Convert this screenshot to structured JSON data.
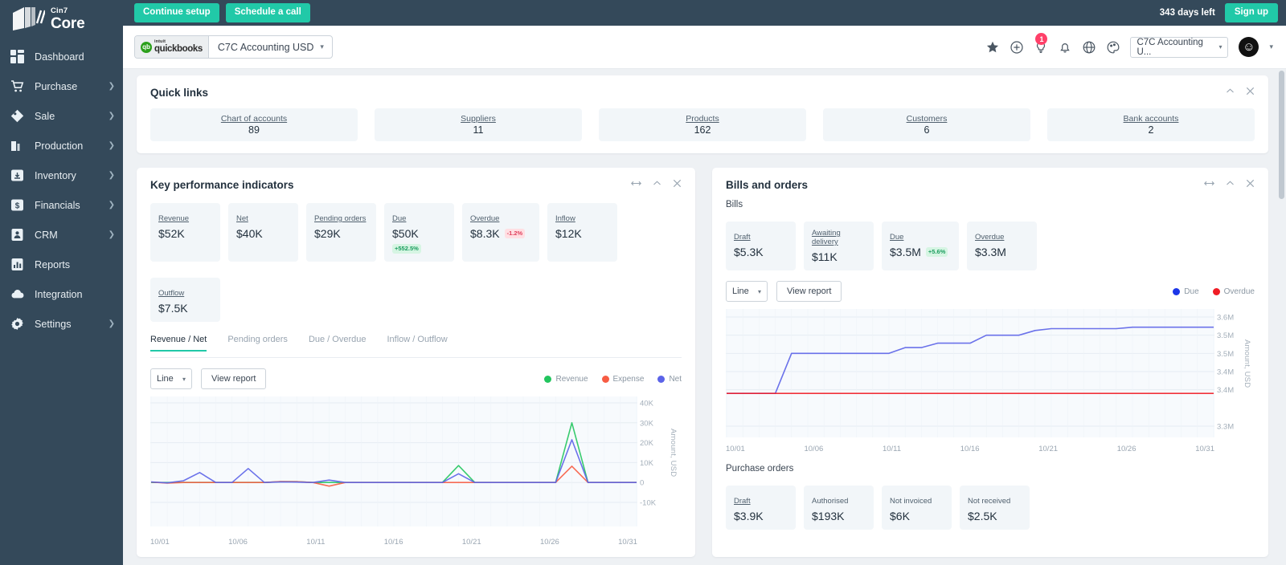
{
  "brand": {
    "top": "Cin7",
    "bottom": "Core"
  },
  "sidebar": {
    "items": [
      {
        "label": "Dashboard",
        "icon": "grid-icon",
        "expandable": false
      },
      {
        "label": "Purchase",
        "icon": "cart-icon",
        "expandable": true
      },
      {
        "label": "Sale",
        "icon": "tag-icon",
        "expandable": true
      },
      {
        "label": "Production",
        "icon": "factory-icon",
        "expandable": true
      },
      {
        "label": "Inventory",
        "icon": "box-icon",
        "expandable": true
      },
      {
        "label": "Financials",
        "icon": "dollar-icon",
        "expandable": true
      },
      {
        "label": "CRM",
        "icon": "contact-icon",
        "expandable": true
      },
      {
        "label": "Reports",
        "icon": "bar-chart-icon",
        "expandable": false
      },
      {
        "label": "Integration",
        "icon": "cloud-icon",
        "expandable": false
      },
      {
        "label": "Settings",
        "icon": "gear-icon",
        "expandable": true
      }
    ]
  },
  "topbar": {
    "continue_setup": "Continue setup",
    "schedule_call": "Schedule a call",
    "days_left": "343 days left",
    "signup": "Sign up",
    "accent": "#21c9a8"
  },
  "subheader": {
    "connector_brand_small": "intuit",
    "connector_brand": "quickbooks",
    "connector_value": "C7C Accounting USD",
    "notification_count": "1",
    "org_value": "C7C Accounting U...",
    "icons": [
      "star-icon",
      "plus-circle-icon",
      "lightbulb-icon",
      "bell-icon",
      "globe-icon",
      "palette-icon"
    ]
  },
  "quick_links": {
    "title": "Quick links",
    "tiles": [
      {
        "label": "Chart of accounts",
        "value": "89"
      },
      {
        "label": "Suppliers",
        "value": "11"
      },
      {
        "label": "Products",
        "value": "162"
      },
      {
        "label": "Customers",
        "value": "6"
      },
      {
        "label": "Bank accounts",
        "value": "2"
      }
    ]
  },
  "kpi": {
    "title": "Key performance indicators",
    "tiles": [
      {
        "label": "Revenue",
        "value": "$52K",
        "pill": "",
        "pill_dir": ""
      },
      {
        "label": "Net",
        "value": "$40K",
        "pill": "",
        "pill_dir": ""
      },
      {
        "label": "Pending orders",
        "value": "$29K",
        "pill": "",
        "pill_dir": ""
      },
      {
        "label": "Due",
        "value": "$50K",
        "pill": "+552.5%",
        "pill_dir": "up"
      },
      {
        "label": "Overdue",
        "value": "$8.3K",
        "pill": "-1.2%",
        "pill_dir": "down"
      },
      {
        "label": "Inflow",
        "value": "$12K",
        "pill": "",
        "pill_dir": ""
      },
      {
        "label": "Outflow",
        "value": "$7.5K",
        "pill": "",
        "pill_dir": ""
      }
    ],
    "tabs": [
      {
        "label": "Revenue / Net",
        "active": true
      },
      {
        "label": "Pending orders",
        "active": false
      },
      {
        "label": "Due / Overdue",
        "active": false
      },
      {
        "label": "Inflow / Outflow",
        "active": false
      }
    ],
    "chart_type": "Line",
    "view_report": "View report",
    "legend": [
      {
        "label": "Revenue",
        "color": "#22c55e"
      },
      {
        "label": "Expense",
        "color": "#f75c43"
      },
      {
        "label": "Net",
        "color": "#5b63e8"
      }
    ]
  },
  "bills": {
    "title": "Bills and orders",
    "bills_label": "Bills",
    "bills_tiles": [
      {
        "label": "Draft",
        "value": "$5.3K",
        "pill": "",
        "pill_dir": ""
      },
      {
        "label": "Awaiting delivery",
        "value": "$11K",
        "pill": "",
        "pill_dir": ""
      },
      {
        "label": "Due",
        "value": "$3.5M",
        "pill": "+5.6%",
        "pill_dir": "up"
      },
      {
        "label": "Overdue",
        "value": "$3.3M",
        "pill": "",
        "pill_dir": ""
      }
    ],
    "chart_type": "Line",
    "view_report": "View report",
    "legend": [
      {
        "label": "Due",
        "color": "#1c36e8"
      },
      {
        "label": "Overdue",
        "color": "#f01c25"
      }
    ],
    "purchase_orders_label": "Purchase orders",
    "po_tiles": [
      {
        "label": "Draft",
        "value": "$3.9K"
      },
      {
        "label": "Authorised",
        "value": "$193K"
      },
      {
        "label": "Not invoiced",
        "value": "$6K"
      },
      {
        "label": "Not received",
        "value": "$2.5K"
      }
    ]
  },
  "chart_data": [
    {
      "id": "kpi-revenue-net",
      "type": "line",
      "title": "Revenue / Net",
      "xlabel": "",
      "ylabel": "Amount, USD",
      "ylim": [
        -10000,
        40000
      ],
      "yticks": [
        40000,
        30000,
        20000,
        10000,
        0,
        -10000
      ],
      "ytick_labels": [
        "40K",
        "30K",
        "20K",
        "10K",
        "0",
        "-10K"
      ],
      "x": [
        "10/01",
        "10/02",
        "10/03",
        "10/04",
        "10/05",
        "10/06",
        "10/07",
        "10/08",
        "10/09",
        "10/10",
        "10/11",
        "10/12",
        "10/13",
        "10/14",
        "10/15",
        "10/16",
        "10/17",
        "10/18",
        "10/19",
        "10/20",
        "10/21",
        "10/22",
        "10/23",
        "10/24",
        "10/25",
        "10/26",
        "10/27",
        "10/28",
        "10/29",
        "10/30",
        "10/31"
      ],
      "xtick_labels": [
        "10/01",
        "10/06",
        "10/11",
        "10/16",
        "10/21",
        "10/26",
        "10/31"
      ],
      "grid": true,
      "legend_position": "top-right",
      "series": [
        {
          "name": "Revenue",
          "color": "#22c55e",
          "values": [
            0,
            0,
            0,
            0,
            0,
            0,
            0,
            0,
            400,
            400,
            0,
            0,
            0,
            0,
            0,
            0,
            0,
            0,
            0,
            8500,
            0,
            0,
            0,
            0,
            0,
            0,
            30000,
            0,
            0,
            0,
            0
          ]
        },
        {
          "name": "Expense",
          "color": "#f75c43",
          "values": [
            200,
            -300,
            0,
            0,
            0,
            0,
            0,
            0,
            500,
            400,
            0,
            -1800,
            0,
            0,
            0,
            0,
            0,
            0,
            0,
            0,
            0,
            0,
            0,
            0,
            0,
            0,
            8200,
            0,
            0,
            0,
            0
          ]
        },
        {
          "name": "Net",
          "color": "#5b63e8",
          "values": [
            300,
            -200,
            900,
            5000,
            0,
            0,
            7000,
            0,
            300,
            200,
            0,
            1200,
            0,
            0,
            0,
            0,
            0,
            0,
            0,
            4400,
            0,
            0,
            0,
            0,
            0,
            0,
            21500,
            0,
            0,
            0,
            0
          ]
        }
      ]
    },
    {
      "id": "bills-due-overdue",
      "type": "line",
      "title": "Bills",
      "xlabel": "",
      "ylabel": "Amount, USD",
      "ylim": [
        3300000,
        3600000
      ],
      "yticks": [
        3600000,
        3550000,
        3500000,
        3450000,
        3400000,
        3300000
      ],
      "ytick_labels": [
        "3.6M",
        "3.5M",
        "3.5M",
        "3.4M",
        "3.4M",
        "3.3M"
      ],
      "x": [
        "10/01",
        "10/02",
        "10/03",
        "10/04",
        "10/05",
        "10/06",
        "10/07",
        "10/08",
        "10/09",
        "10/10",
        "10/11",
        "10/12",
        "10/13",
        "10/14",
        "10/15",
        "10/16",
        "10/17",
        "10/18",
        "10/19",
        "10/20",
        "10/21",
        "10/22",
        "10/23",
        "10/24",
        "10/25",
        "10/26",
        "10/27",
        "10/28",
        "10/29",
        "10/30",
        "10/31"
      ],
      "xtick_labels": [
        "10/01",
        "10/06",
        "10/11",
        "10/16",
        "10/21",
        "10/26",
        "10/31"
      ],
      "grid": true,
      "legend_position": "top-right",
      "series": [
        {
          "name": "Due",
          "color": "#5b63e8",
          "values": [
            3390000,
            3390000,
            3390000,
            3390000,
            3500000,
            3500000,
            3500000,
            3500000,
            3500000,
            3500000,
            3500000,
            3516000,
            3516000,
            3528000,
            3528000,
            3528000,
            3550000,
            3550000,
            3550000,
            3563000,
            3568000,
            3568000,
            3568000,
            3568000,
            3568000,
            3572000,
            3572000,
            3572000,
            3572000,
            3572000,
            3572000
          ]
        },
        {
          "name": "Overdue",
          "color": "#f01c25",
          "values": [
            3390000,
            3390000,
            3390000,
            3390000,
            3390000,
            3390000,
            3390000,
            3390000,
            3390000,
            3390000,
            3390000,
            3390000,
            3390000,
            3390000,
            3390000,
            3390000,
            3390000,
            3390000,
            3390000,
            3390000,
            3390000,
            3390000,
            3390000,
            3390000,
            3390000,
            3390000,
            3390000,
            3390000,
            3390000,
            3390000,
            3390000
          ]
        }
      ]
    }
  ]
}
